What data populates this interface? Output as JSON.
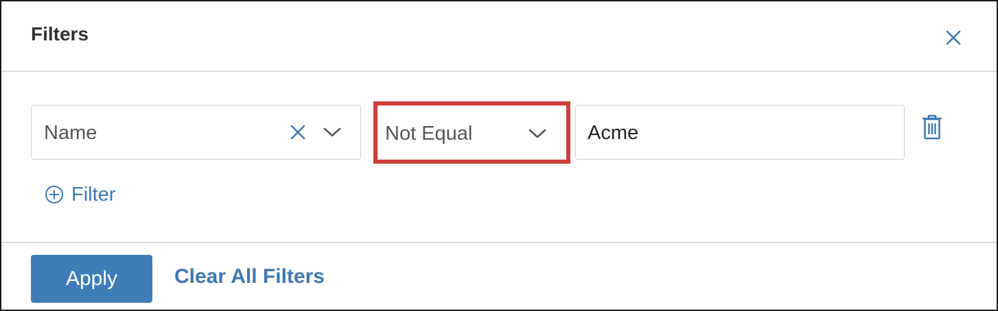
{
  "dialog": {
    "title": "Filters",
    "close_icon": "close-icon"
  },
  "filter_row": {
    "field": {
      "value": "Name",
      "clear_icon": "clear-icon",
      "dropdown_icon": "chevron-down-icon"
    },
    "operator": {
      "value": "Not Equal",
      "dropdown_icon": "chevron-down-icon",
      "highlighted": true
    },
    "value": {
      "value": "Acme"
    },
    "delete_icon": "trash-icon"
  },
  "add_filter": {
    "label": "Filter",
    "icon": "plus-circle-icon"
  },
  "footer": {
    "apply_label": "Apply",
    "clear_all_label": "Clear All Filters"
  },
  "colors": {
    "accent": "#3f7db8",
    "link": "#3d79b0",
    "highlight_border": "#cc3f38"
  }
}
